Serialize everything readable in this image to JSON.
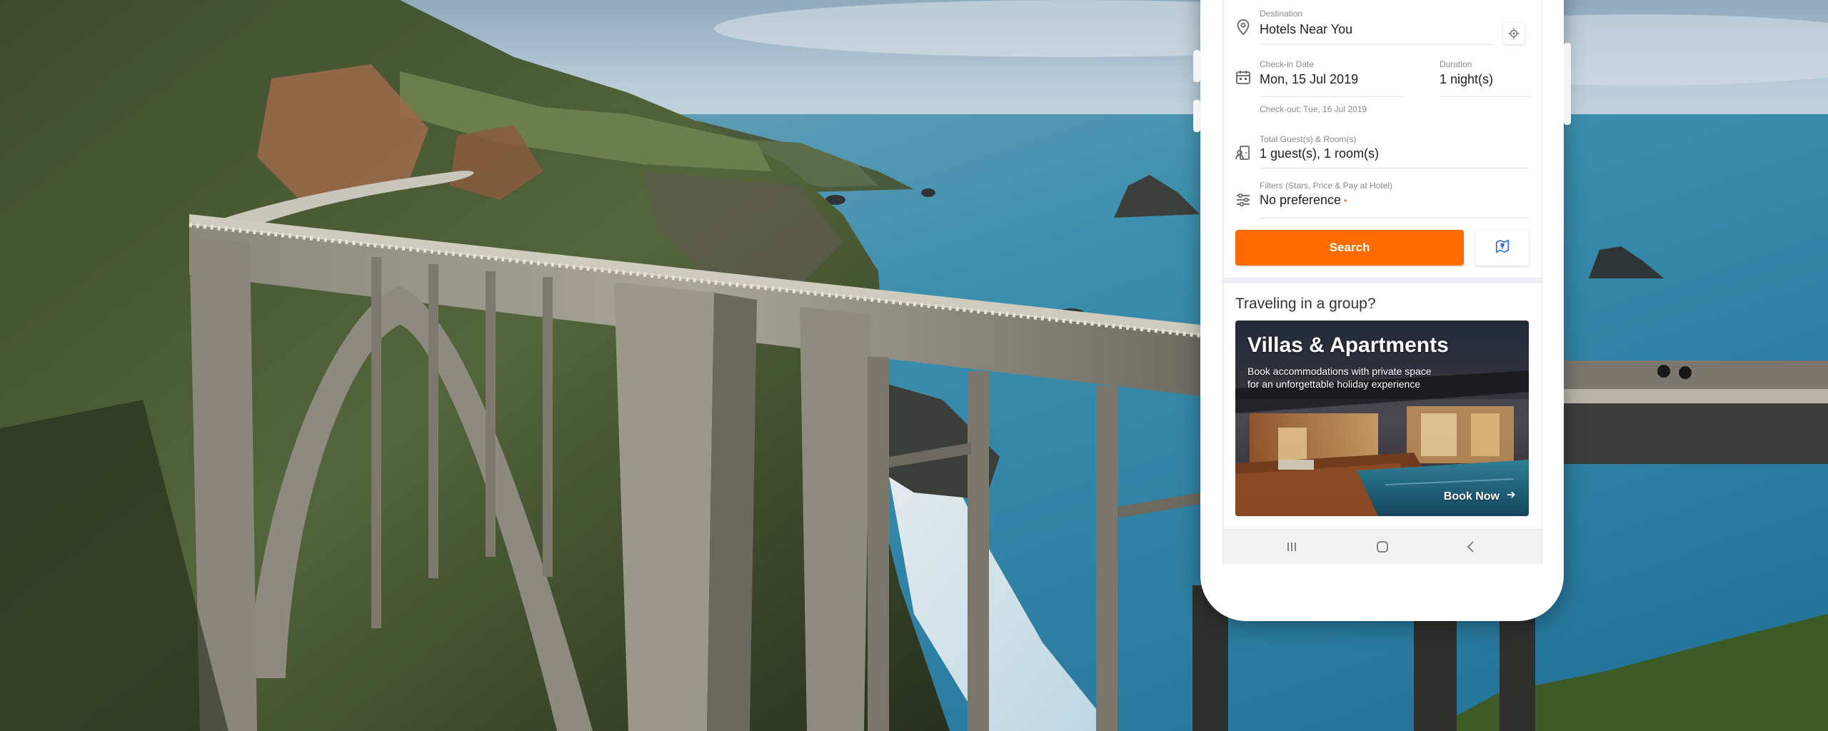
{
  "colors": {
    "accent": "#ff6d00",
    "label": "#8a8a8a",
    "text": "#222222",
    "divider": "#eceff3"
  },
  "form": {
    "destination": {
      "label": "Destination",
      "value": "Hotels Near You",
      "icon": "location-pin-icon",
      "action_icon": "locate-me-icon"
    },
    "checkin": {
      "label": "Check-in Date",
      "value": "Mon, 15 Jul 2019",
      "icon": "calendar-icon"
    },
    "duration": {
      "label": "Duration",
      "value": "1 night(s)"
    },
    "checkout_text": "Check-out: Tue, 16 Jul 2019",
    "guests": {
      "label": "Total Guest(s) & Room(s)",
      "value": "1 guest(s), 1 room(s)",
      "icon": "guests-rooms-icon"
    },
    "filters": {
      "label": "Filters (Stars, Price & Pay at Hotel)",
      "value": "No preference",
      "icon": "filter-sliders-icon"
    },
    "search_label": "Search",
    "map_icon": "map-icon"
  },
  "group_section": {
    "title": "Traveling in a group?",
    "promo": {
      "title": "Villas & Apartments",
      "subtitle": "Book accommodations with private space for an unforgettable holiday experience",
      "cta": "Book Now"
    }
  },
  "navbar": {
    "icons": [
      "recent-apps-icon",
      "home-icon",
      "back-icon"
    ]
  }
}
